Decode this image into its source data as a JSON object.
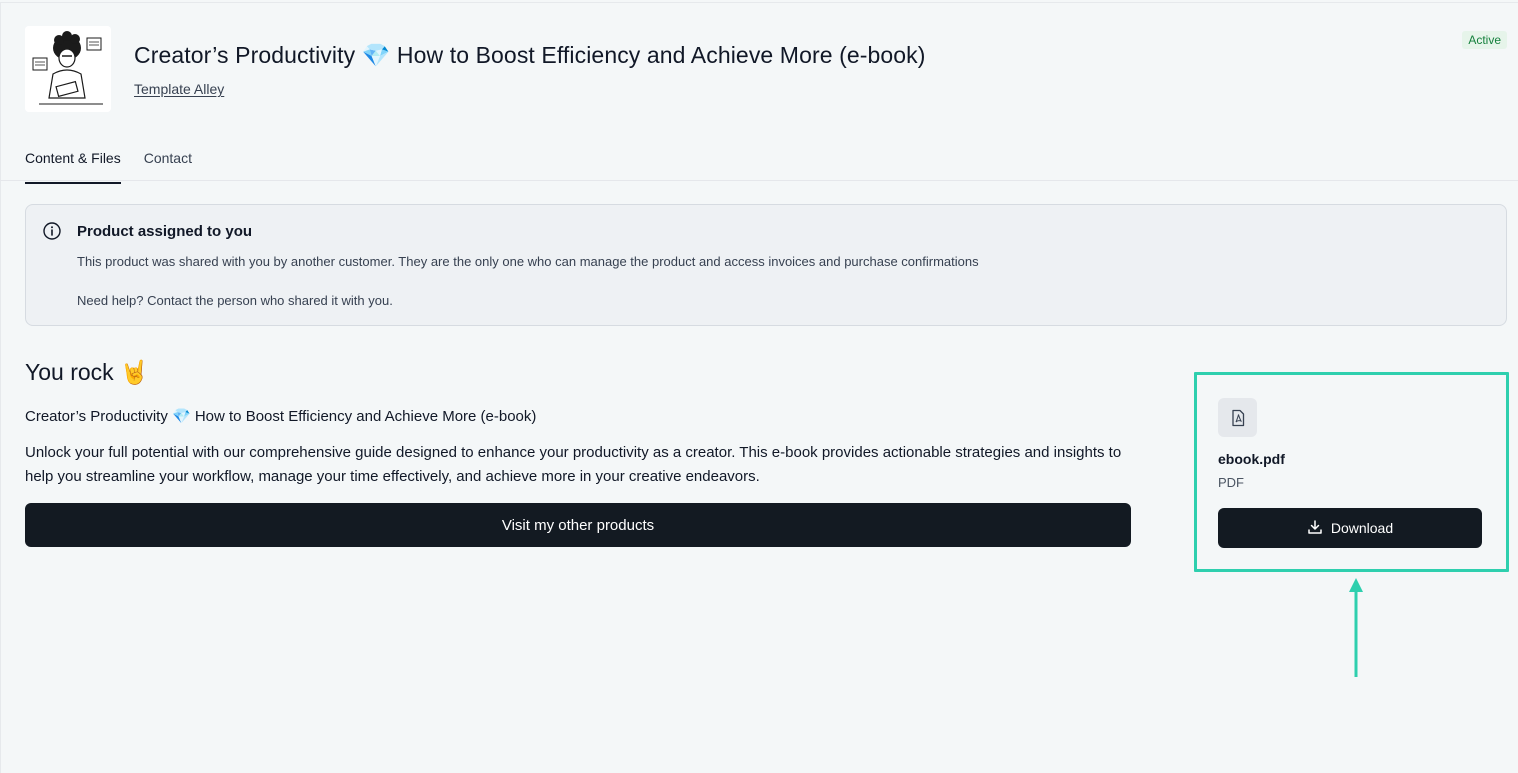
{
  "product": {
    "title": "Creator’s Productivity 💎 How to Boost Efficiency and Achieve More (e-book)",
    "author": "Template Alley",
    "status": "Active"
  },
  "tabs": [
    {
      "label": "Content & Files",
      "active": true
    },
    {
      "label": "Contact",
      "active": false
    }
  ],
  "notice": {
    "icon": "info-icon",
    "heading": "Product assigned to you",
    "line1": "This product was shared with you by another customer. They are the only one who can manage the product and access invoices and purchase confirmations",
    "line2": "Need help? Contact the person who shared it with you."
  },
  "content": {
    "heading": "You rock 🤘",
    "subtitle": "Creator’s Productivity 💎 How to Boost Efficiency and Achieve More (e-book)",
    "description": "Unlock your full potential with our comprehensive guide designed to enhance your productivity as a creator. This e-book provides actionable strategies and insights to help you streamline your workflow, manage your time effectively, and achieve more in your creative endeavors.",
    "visit_button": "Visit my other products"
  },
  "file": {
    "icon": "pdf-icon",
    "name": "ebook.pdf",
    "type": "PDF",
    "download_label": "Download",
    "download_icon": "download-icon"
  },
  "colors": {
    "background": "#f4f7f8",
    "button": "#131a22",
    "highlight": "#2ecfae",
    "status_text": "#15803d"
  }
}
